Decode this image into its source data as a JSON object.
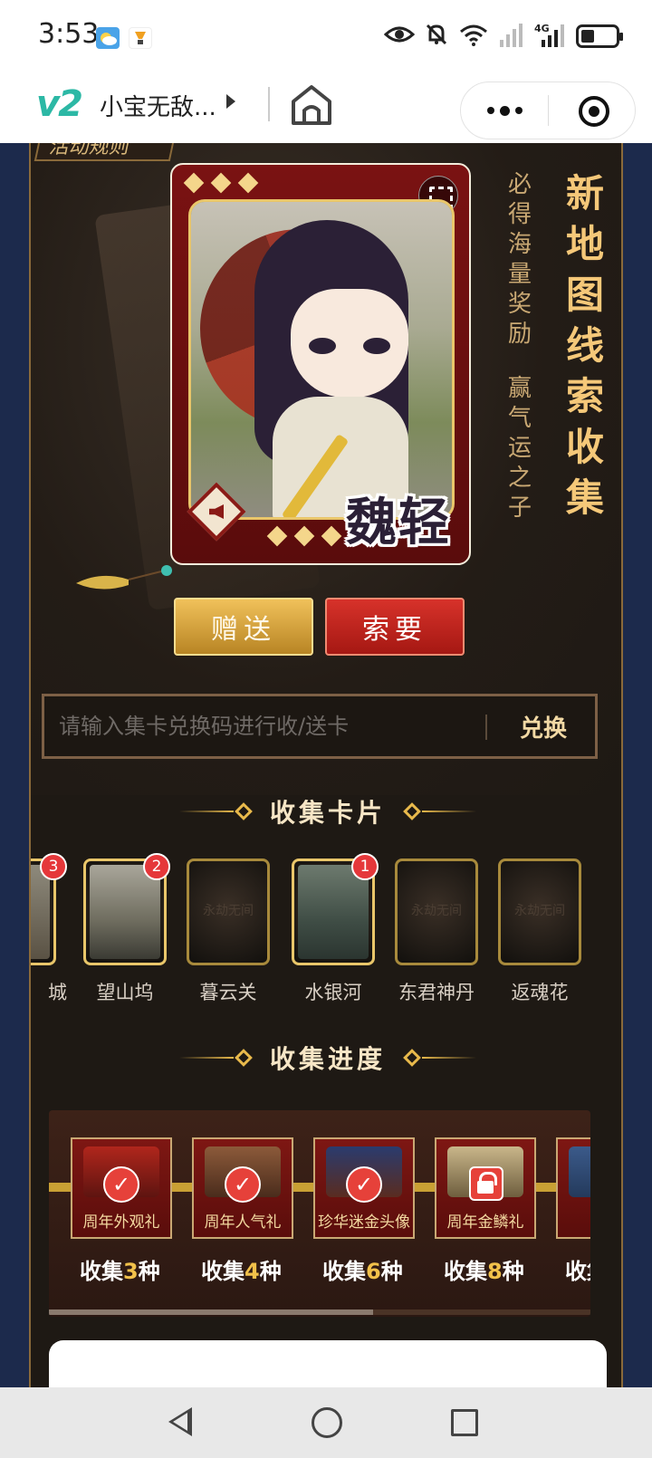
{
  "status_bar": {
    "time": "3:53",
    "icons": [
      "weather-icon",
      "notification-icon",
      "eye-icon",
      "bell-off-icon",
      "wifi-icon",
      "signal-icon",
      "4g-signal-icon",
      "battery-icon"
    ],
    "battery_level": 0.35
  },
  "nav": {
    "logo": "v2",
    "title": "小宝无敌...",
    "icons": [
      "home-icon",
      "more-icon",
      "close-target-icon"
    ]
  },
  "event": {
    "rules_tab": "活动规则",
    "slogan_small": [
      "必得海量奖励",
      "赢气运之子"
    ],
    "slogan_big": "新地图线索收集"
  },
  "featured_card": {
    "name": "魏轻"
  },
  "actions": {
    "gift": "赠送",
    "ask": "索要"
  },
  "redeem": {
    "placeholder": "请输入集卡兑换码进行收/送卡",
    "button": "兑换"
  },
  "collect_cards": {
    "title": "收集卡片",
    "cards": [
      {
        "name": "城",
        "count": "3",
        "owned": true
      },
      {
        "name": "望山坞",
        "count": "2",
        "owned": true
      },
      {
        "name": "暮云关",
        "count": null,
        "owned": false
      },
      {
        "name": "水银河",
        "count": "1",
        "owned": true
      },
      {
        "name": "东君神丹",
        "count": null,
        "owned": false
      },
      {
        "name": "返魂花",
        "count": null,
        "owned": false
      }
    ],
    "card_watermark": "永劫无间"
  },
  "progress": {
    "title": "收集进度",
    "rewards": [
      {
        "name": "周年外观礼",
        "prefix": "收集",
        "num": "3",
        "suffix": "种",
        "status": "done"
      },
      {
        "name": "周年人气礼",
        "prefix": "收集",
        "num": "4",
        "suffix": "种",
        "status": "done"
      },
      {
        "name": "珍华迷金头像",
        "prefix": "收集",
        "num": "6",
        "suffix": "种",
        "status": "done"
      },
      {
        "name": "周年金鳞礼",
        "prefix": "收集",
        "num": "8",
        "suffix": "种",
        "status": "locked"
      },
      {
        "name": "周年",
        "prefix": "收集",
        "num": "",
        "suffix": "",
        "status": "done"
      }
    ],
    "scroll_position": 0.6
  },
  "colors": {
    "accent_gold": "#e8b94b",
    "accent_red": "#d7322a",
    "panel_bg": "#1e1914"
  }
}
